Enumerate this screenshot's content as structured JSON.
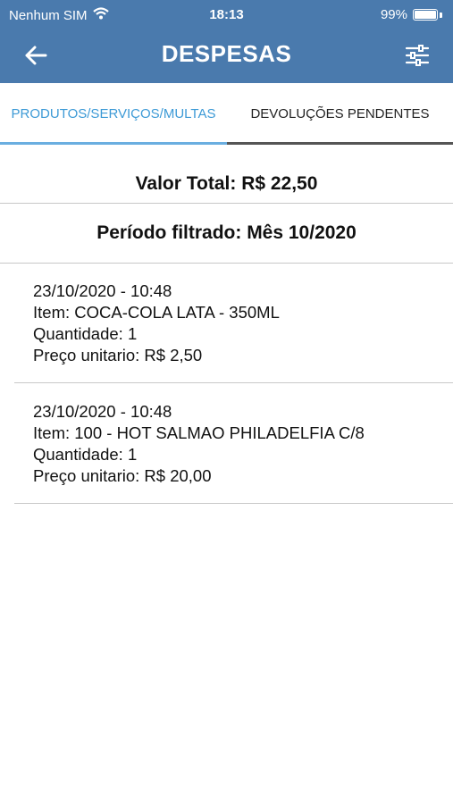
{
  "status": {
    "carrier": "Nenhum SIM",
    "time": "18:13",
    "battery": "99%"
  },
  "header": {
    "title": "DESPESAS"
  },
  "tabs": [
    {
      "label": "PRODUTOS/SERVIÇOS/MULTAS"
    },
    {
      "label": "DEVOLUÇÕES PENDENTES"
    }
  ],
  "summary": {
    "total": "Valor Total: R$ 22,50",
    "period": "Período filtrado: Mês 10/2020"
  },
  "entries": [
    {
      "datetime": "23/10/2020 - 10:48",
      "item": "Item: COCA-COLA LATA - 350ML",
      "quantity": "Quantidade: 1",
      "price": "Preço unitario: R$ 2,50"
    },
    {
      "datetime": "23/10/2020 - 10:48",
      "item": "Item: 100 - HOT SALMAO PHILADELFIA C/8",
      "quantity": "Quantidade: 1",
      "price": "Preço unitario: R$ 20,00"
    }
  ],
  "colors": {
    "header": "#4a7aad",
    "active_tab": "#3d9ad6"
  }
}
